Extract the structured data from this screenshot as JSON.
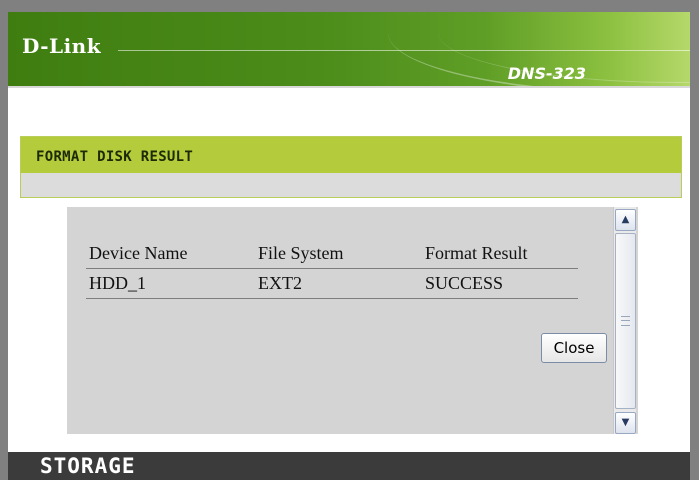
{
  "header": {
    "brand": "D-Link",
    "model": "DNS-323"
  },
  "section": {
    "title": "FORMAT DISK RESULT"
  },
  "dialog": {
    "columns": [
      "Device Name",
      "File System",
      "Format Result"
    ],
    "rows": [
      [
        "HDD_1",
        "EXT2",
        "SUCCESS"
      ]
    ],
    "close_label": "Close"
  },
  "footer": {
    "label": "STORAGE"
  },
  "colors": {
    "banner_green": "#4b8c1a",
    "section_green": "#b4cc3c",
    "footer_dark": "#3b3b3b"
  }
}
